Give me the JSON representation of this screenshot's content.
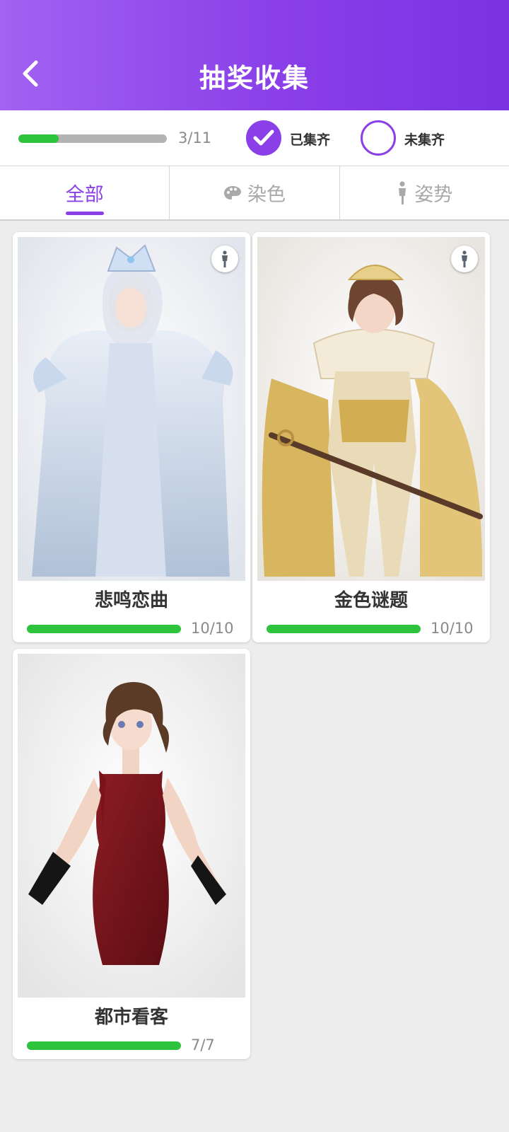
{
  "header": {
    "title": "抽奖收集",
    "back_icon": "chevron-left-icon"
  },
  "progress": {
    "text": "3/11",
    "fraction": 0.2727
  },
  "filters": {
    "collected_label": "已集齐",
    "uncollected_label": "未集齐"
  },
  "tabs": [
    {
      "label": "全部",
      "icon": "",
      "active": true
    },
    {
      "label": "染色",
      "icon": "palette-icon",
      "active": false
    },
    {
      "label": "姿势",
      "icon": "person-icon",
      "active": false
    }
  ],
  "cards": [
    {
      "name": "悲鸣恋曲",
      "count": "10/10",
      "fraction": 1.0,
      "pose_icon": "pose-icon"
    },
    {
      "name": "金色谜题",
      "count": "10/10",
      "fraction": 1.0,
      "pose_icon": "pose-icon"
    },
    {
      "name": "都市看客",
      "count": "7/7",
      "fraction": 1.0,
      "pose_icon": ""
    }
  ],
  "colors": {
    "accent": "#8b3fe6",
    "progress": "#2ec33d",
    "header_start": "#a262f2",
    "header_end": "#7a32e3"
  }
}
